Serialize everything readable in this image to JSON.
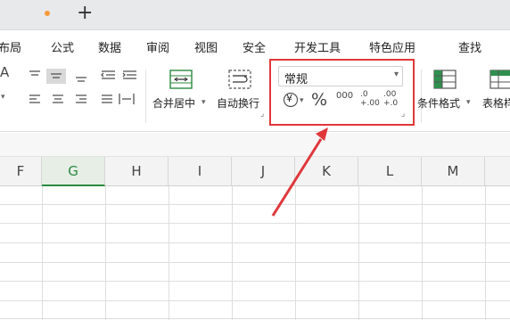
{
  "tabbar": {
    "new_tab_symbol": "+"
  },
  "menu": [
    "布局",
    "公式",
    "数据",
    "审阅",
    "视图",
    "安全",
    "开发工具",
    "特色应用",
    "查找"
  ],
  "ribbon": {
    "font_size_glyph": "A",
    "merge_label": "合并居中",
    "wrap_label": "自动换行",
    "number_format": {
      "value": "常规"
    },
    "currency_symbol": "¥",
    "percent_symbol": "%",
    "thousands_symbol": "000",
    "increase_decimal": ".0 +.00",
    "decrease_decimal": ".00 +.0",
    "conditional_label": "条件格式",
    "table_style_label": "表格样"
  },
  "columns": [
    {
      "label": "F",
      "selected": false
    },
    {
      "label": "G",
      "selected": true
    },
    {
      "label": "H",
      "selected": false
    },
    {
      "label": "I",
      "selected": false
    },
    {
      "label": "J",
      "selected": false
    },
    {
      "label": "K",
      "selected": false
    },
    {
      "label": "L",
      "selected": false
    },
    {
      "label": "M",
      "selected": false
    }
  ],
  "colors": {
    "highlight": "#e0373b",
    "selected_col": "#2b8a3e"
  }
}
